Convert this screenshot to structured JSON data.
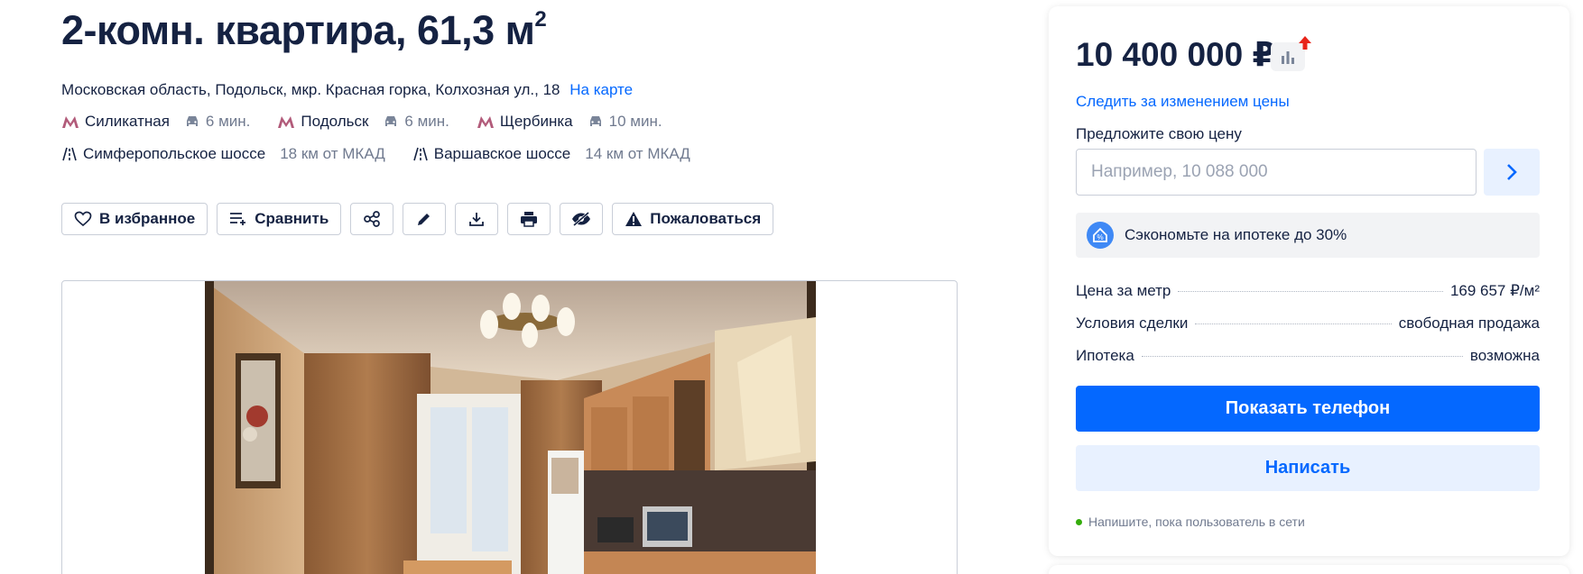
{
  "listing": {
    "title": "2-комн. квартира, 61,3 м",
    "title_sup": "2",
    "address": "Московская область, Подольск, мкр. Красная горка, Колхозная ул., 18",
    "map_link": "На карте",
    "metro": [
      {
        "station": "Силикатная",
        "time": "6 мин."
      },
      {
        "station": "Подольск",
        "time": "6 мин."
      },
      {
        "station": "Щербинка",
        "time": "10 мин."
      }
    ],
    "highways": [
      {
        "name": "Симферопольское шоссе",
        "distance": "18 км от МКАД"
      },
      {
        "name": "Варшавское шоссе",
        "distance": "14 км от МКАД"
      }
    ]
  },
  "actions": {
    "favorite": "В избранное",
    "compare": "Сравнить",
    "complain": "Пожаловаться"
  },
  "sidebar": {
    "price": "10 400 000 ₽",
    "follow_price": "Следить за изменением цены",
    "offer_label": "Предложите свою цену",
    "offer_placeholder": "Например, 10 088 000",
    "mortgage_text": "Сэкономьте на ипотеке до 30%",
    "facts": [
      {
        "label": "Цена за метр",
        "value": "169 657 ₽/м²"
      },
      {
        "label": "Условия сделки",
        "value": "свободная продажа"
      },
      {
        "label": "Ипотека",
        "value": "возможна"
      }
    ],
    "show_phone": "Показать телефон",
    "write": "Написать",
    "online_hint": "Напишите, пока пользователь в сети"
  },
  "colors": {
    "accent": "#0468ff",
    "accent_light": "#e8f1ff",
    "text": "#152242",
    "muted": "#707a8f",
    "metro": "#b25b7a",
    "online": "#34ac0a",
    "price_up": "#e8241a"
  }
}
